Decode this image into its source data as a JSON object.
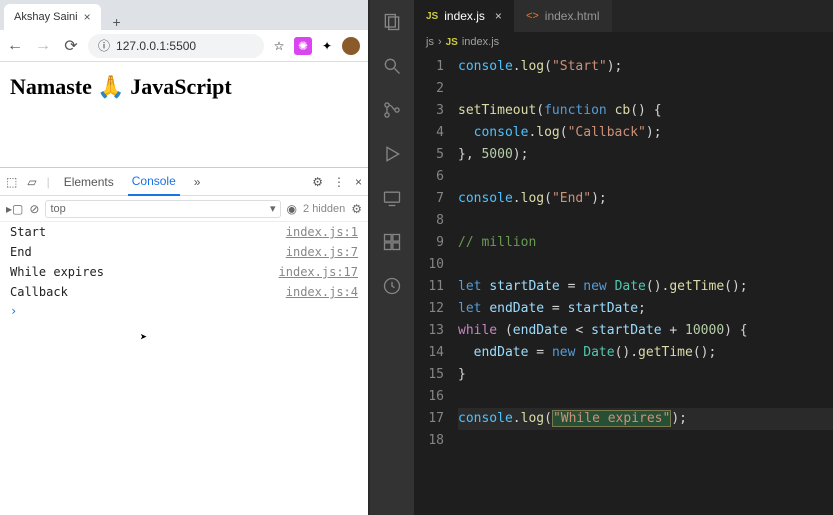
{
  "browser": {
    "tab_title": "Akshay Saini",
    "url": "127.0.0.1:5500",
    "page_heading": "Namaste 🙏 JavaScript"
  },
  "devtools": {
    "tabs": {
      "elements": "Elements",
      "console": "Console",
      "more": "»"
    },
    "context": "top",
    "hidden_count": "2 hidden",
    "logs": [
      {
        "msg": "Start",
        "src": "index.js:1"
      },
      {
        "msg": "End",
        "src": "index.js:7"
      },
      {
        "msg": "While expires",
        "src": "index.js:17"
      },
      {
        "msg": "Callback",
        "src": "index.js:4"
      }
    ]
  },
  "vscode": {
    "tabs": {
      "active": "index.js",
      "other": "index.html"
    },
    "breadcrumb": {
      "folder": "js",
      "file": "index.js",
      "icon": "JS"
    },
    "code": {
      "l1": {
        "obj": "console",
        "fn": "log",
        "str": "\"Start\""
      },
      "l3a": {
        "fn": "setTimeout",
        "kw": "function",
        "name": "cb"
      },
      "l4": {
        "obj": "console",
        "fn": "log",
        "str": "\"Callback\""
      },
      "l5": {
        "num": "5000"
      },
      "l7": {
        "obj": "console",
        "fn": "log",
        "str": "\"End\""
      },
      "l9": {
        "cmt": "// million"
      },
      "l11": {
        "kw": "let",
        "var": "startDate",
        "nw": "new",
        "cls": "Date",
        "fn": "getTime"
      },
      "l12": {
        "kw": "let",
        "var": "endDate",
        "rhs": "startDate"
      },
      "l13": {
        "kw": "while",
        "v1": "endDate",
        "v2": "startDate",
        "num": "10000"
      },
      "l14": {
        "var": "endDate",
        "nw": "new",
        "cls": "Date",
        "fn": "getTime"
      },
      "l17": {
        "obj": "console",
        "fn": "log",
        "str": "\"While expires\""
      }
    },
    "lines": [
      "1",
      "2",
      "3",
      "4",
      "5",
      "6",
      "7",
      "8",
      "9",
      "10",
      "11",
      "12",
      "13",
      "14",
      "15",
      "16",
      "17",
      "18"
    ]
  }
}
